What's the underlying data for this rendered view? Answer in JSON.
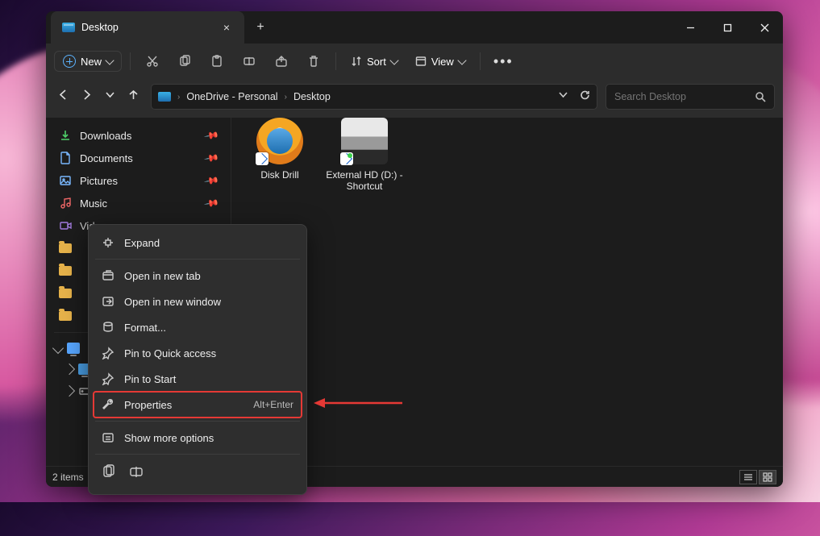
{
  "tab": {
    "title": "Desktop"
  },
  "toolbar": {
    "new_label": "New",
    "sort_label": "Sort",
    "view_label": "View"
  },
  "breadcrumb": {
    "root": "OneDrive - Personal",
    "leaf": "Desktop"
  },
  "search": {
    "placeholder": "Search Desktop"
  },
  "sidebar": {
    "items": [
      {
        "label": "Downloads",
        "icon": "download"
      },
      {
        "label": "Documents",
        "icon": "document"
      },
      {
        "label": "Pictures",
        "icon": "picture"
      },
      {
        "label": "Music",
        "icon": "music"
      },
      {
        "label": "Videos",
        "icon": "video"
      }
    ],
    "folders": [
      "",
      "",
      "",
      ""
    ],
    "tree_root": ""
  },
  "files": [
    {
      "name": "Disk Drill",
      "kind": "disk-drill"
    },
    {
      "name": "External HD (D:) - Shortcut",
      "kind": "drive"
    }
  ],
  "statusbar": {
    "count": "2 items"
  },
  "context_menu": {
    "items": [
      {
        "label": "Expand",
        "icon": "expand",
        "shortcut": ""
      },
      {
        "divider": true
      },
      {
        "label": "Open in new tab",
        "icon": "newtab",
        "shortcut": ""
      },
      {
        "label": "Open in new window",
        "icon": "newwin",
        "shortcut": ""
      },
      {
        "label": "Format...",
        "icon": "format",
        "shortcut": ""
      },
      {
        "label": "Pin to Quick access",
        "icon": "pin",
        "shortcut": ""
      },
      {
        "label": "Pin to Start",
        "icon": "pinstart",
        "shortcut": ""
      },
      {
        "label": "Properties",
        "icon": "wrench",
        "shortcut": "Alt+Enter",
        "highlight": true
      },
      {
        "divider": true
      },
      {
        "label": "Show more options",
        "icon": "more",
        "shortcut": ""
      }
    ]
  },
  "colors": {
    "accent": "#e53935"
  }
}
